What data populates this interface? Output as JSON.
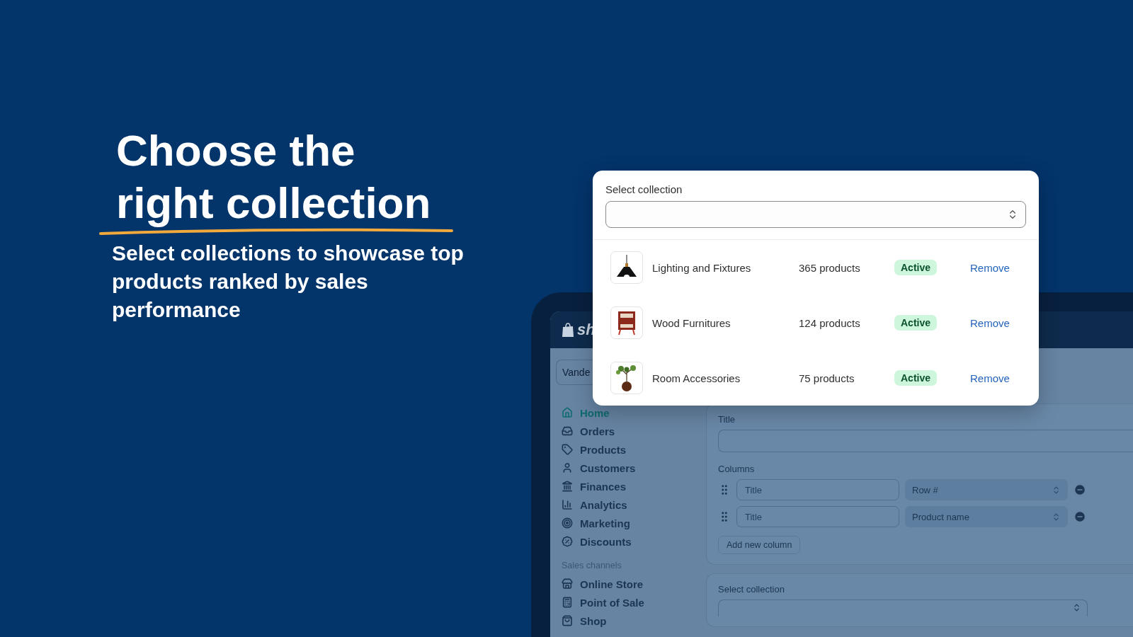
{
  "headline": {
    "line_1": "Choose the",
    "line_2": "right collection"
  },
  "subtitle": "Select collections to showcase top products ranked by sales performance",
  "popup": {
    "label": "Select collection",
    "collections": [
      {
        "name": "Lighting and Fixtures",
        "count": "365 products",
        "status": "Active",
        "action": "Remove",
        "kind": "lamp"
      },
      {
        "name": "Wood Furnitures",
        "count": "124 products",
        "status": "Active",
        "action": "Remove",
        "kind": "cabinet"
      },
      {
        "name": "Room Accessories",
        "count": "75 products",
        "status": "Active",
        "action": "Remove",
        "kind": "plant"
      }
    ]
  },
  "admin": {
    "logo": "sh",
    "store": "Vande",
    "nav": [
      {
        "label": "Home",
        "kind": "home",
        "selected": true
      },
      {
        "label": "Orders",
        "kind": "orders",
        "selected": false
      },
      {
        "label": "Products",
        "kind": "tag",
        "selected": false
      },
      {
        "label": "Customers",
        "kind": "person",
        "selected": false
      },
      {
        "label": "Finances",
        "kind": "bank",
        "selected": false
      },
      {
        "label": "Analytics",
        "kind": "chart",
        "selected": false
      },
      {
        "label": "Marketing",
        "kind": "target",
        "selected": false
      },
      {
        "label": "Discounts",
        "kind": "percent",
        "selected": false
      }
    ],
    "section": "Sales channels",
    "channels": [
      {
        "label": "Online Store",
        "kind": "store"
      },
      {
        "label": "Point of Sale",
        "kind": "pos"
      },
      {
        "label": "Shop",
        "kind": "bag"
      }
    ],
    "form": {
      "title_label": "Title",
      "columns_label": "Columns",
      "columns": [
        {
          "placeholder": "Title",
          "value": "Row #"
        },
        {
          "placeholder": "Title",
          "value": "Product name"
        }
      ],
      "add_button": "Add new column"
    },
    "collection_card": {
      "label": "Select collection"
    }
  }
}
